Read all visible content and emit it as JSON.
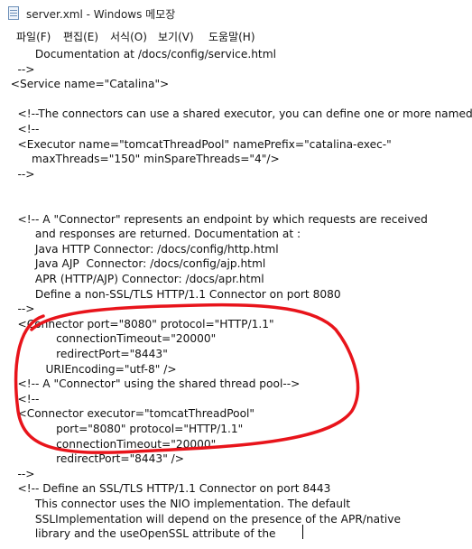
{
  "window": {
    "title": "server.xml - Windows 메모장",
    "icon": "notepad-icon"
  },
  "menu": [
    "파일(F)",
    "편집(E)",
    "서식(O)",
    "보기(V)",
    "도움말(H)"
  ],
  "editor": {
    "lines": [
      "         Documentation at /docs/config/service.html",
      "    -->",
      "  <Service name=\"Catalina\">",
      "",
      "    <!--The connectors can use a shared executor, you can define one or more named thread pools-->",
      "    <!--",
      "    <Executor name=\"tomcatThreadPool\" namePrefix=\"catalina-exec-\"",
      "        maxThreads=\"150\" minSpareThreads=\"4\"/>",
      "    -->",
      "",
      "",
      "    <!-- A \"Connector\" represents an endpoint by which requests are received",
      "         and responses are returned. Documentation at :",
      "         Java HTTP Connector: /docs/config/http.html",
      "         Java AJP  Connector: /docs/config/ajp.html",
      "         APR (HTTP/AJP) Connector: /docs/apr.html",
      "         Define a non-SSL/TLS HTTP/1.1 Connector on port 8080",
      "    -->",
      "    <Connector port=\"8080\" protocol=\"HTTP/1.1\"",
      "               connectionTimeout=\"20000\"",
      "               redirectPort=\"8443\"",
      "            URIEncoding=\"utf-8\" />",
      "    <!-- A \"Connector\" using the shared thread pool-->",
      "    <!--",
      "    <Connector executor=\"tomcatThreadPool\"",
      "               port=\"8080\" protocol=\"HTTP/1.1\"",
      "               connectionTimeout=\"20000\"",
      "               redirectPort=\"8443\" />",
      "    -->",
      "    <!-- Define an SSL/TLS HTTP/1.1 Connector on port 8443",
      "         This connector uses the NIO implementation. The default",
      "         SSLImplementation will depend on the presence of the APR/native",
      "         library and the useOpenSSL attribute of the"
    ]
  },
  "annotation": {
    "color": "#e8141b"
  }
}
